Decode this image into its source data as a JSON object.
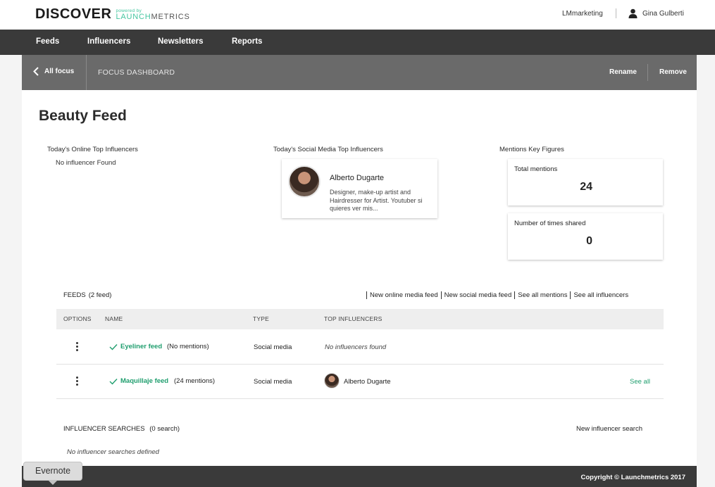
{
  "header": {
    "logo": {
      "main": "DISCOVER",
      "powered": "powered by",
      "brand_accent": "LAUNCH",
      "brand_rest": "METRICS"
    },
    "account": "LMmarketing",
    "user_name": "Gina Gulberti"
  },
  "nav": {
    "items": [
      "Feeds",
      "Influencers",
      "Newsletters",
      "Reports"
    ]
  },
  "subheader": {
    "back_label": "All focus",
    "title": "FOCUS DASHBOARD",
    "rename_label": "Rename",
    "remove_label": "Remove"
  },
  "page": {
    "title": "Beauty Feed",
    "online_influencers": {
      "heading": "Today's Online Top Influencers",
      "empty": "No influencer Found"
    },
    "social_influencers": {
      "heading": "Today's Social Media Top Influencers",
      "card": {
        "name": "Alberto Dugarte",
        "description": "Designer, make-up artist and Hairdresser for Artist. Youtuber si quieres ver mis..."
      }
    },
    "key_figures": {
      "heading": "Mentions Key Figures",
      "items": [
        {
          "label": "Total mentions",
          "value": "24"
        },
        {
          "label": "Number of times shared",
          "value": "0"
        }
      ]
    }
  },
  "feeds": {
    "heading": "FEEDS",
    "count": "(2 feed)",
    "links": [
      "New online media feed",
      "New social media feed",
      "See all mentions",
      "See all influencers"
    ],
    "columns": [
      "OPTIONS",
      "NAME",
      "TYPE",
      "TOP INFLUENCERS"
    ],
    "rows": [
      {
        "name": "Eyeliner feed",
        "mentions": "(No mentions)",
        "type": "Social media",
        "influencers": "No influencers found",
        "see_all": ""
      },
      {
        "name": "Maquillaje feed",
        "mentions": "(24 mentions)",
        "type": "Social media",
        "influencers": "Alberto Dugarte",
        "see_all": "See all"
      }
    ]
  },
  "influencer_searches": {
    "heading": "INFLUENCER SEARCHES",
    "count": "(0 search)",
    "new_label": "New influencer search",
    "empty": "No influencer searches defined"
  },
  "footer": {
    "copyright": "Copyright © Launchmetrics 2017"
  },
  "evernote": {
    "label": "Evernote"
  },
  "colors": {
    "accent": "#1f9e6e",
    "nav_bg": "#3a3a3a",
    "subheader_bg": "#6a6a6a"
  }
}
